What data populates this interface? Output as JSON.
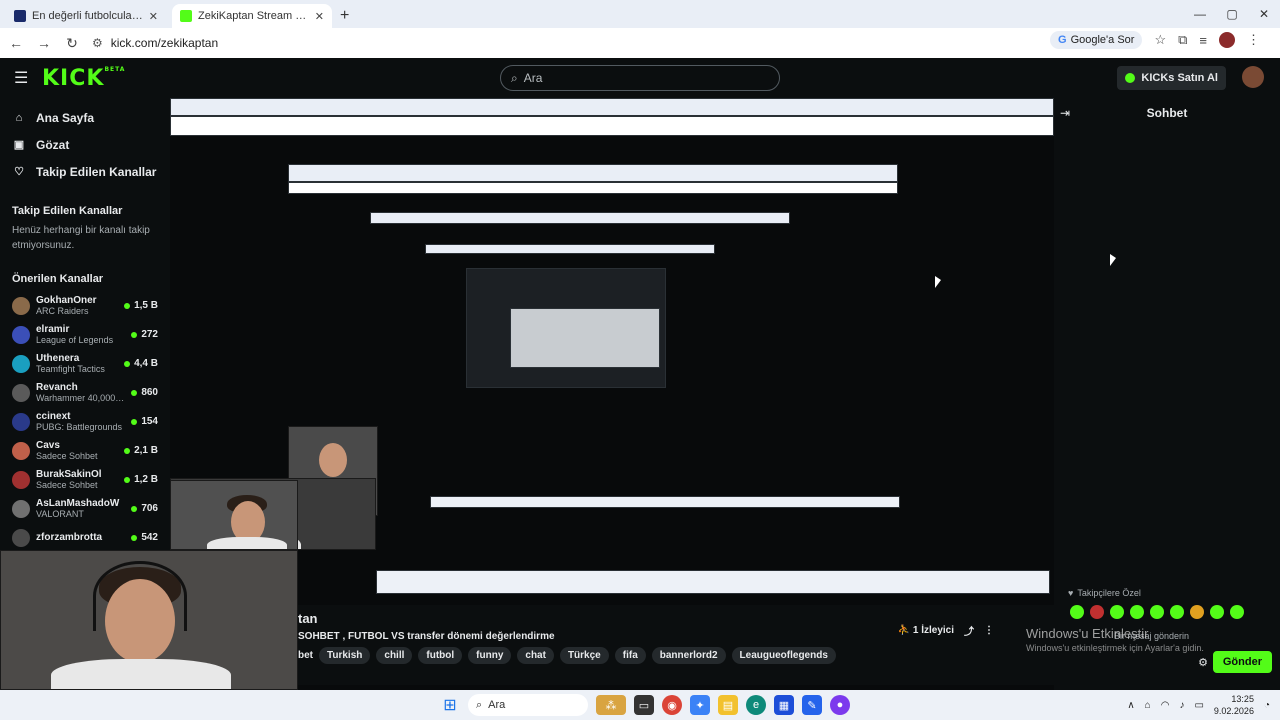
{
  "browser": {
    "tabs": [
      {
        "title": "En değerli futbolcular | Transfer",
        "active": false
      },
      {
        "title": "ZekiKaptan Stream - Watch Live",
        "active": true
      }
    ],
    "url": "kick.com/zekikaptan",
    "google_label": "Google'a Sor"
  },
  "header": {
    "logo": "KICK",
    "beta": "BETA",
    "search_placeholder": "Ara",
    "buy_kicks": "KICKs Satın Al"
  },
  "sidebar": {
    "nav": [
      {
        "label": "Ana Sayfa",
        "icon": "home-icon"
      },
      {
        "label": "Gözat",
        "icon": "browse-icon"
      },
      {
        "label": "Takip Edilen Kanallar",
        "icon": "heart-icon"
      }
    ],
    "following_title": "Takip Edilen Kanallar",
    "following_note": "Henüz herhangi bir kanalı takip etmiyorsunuz.",
    "recommended_title": "Önerilen Kanallar",
    "channels": [
      {
        "name": "GokhanOner",
        "game": "ARC Raiders",
        "count": "1,5 B",
        "color": "#8a6a4a"
      },
      {
        "name": "elramir",
        "game": "League of Legends",
        "count": "272",
        "color": "#3b4fb8"
      },
      {
        "name": "Uthenera",
        "game": "Teamfight Tactics",
        "count": "4,4 B",
        "color": "#1a9fc0"
      },
      {
        "name": "Revanch",
        "game": "Warhammer 40,000: ...",
        "count": "860",
        "color": "#5a5a5a"
      },
      {
        "name": "ccinext",
        "game": "PUBG: Battlegrounds",
        "count": "154",
        "color": "#2a3a8a"
      },
      {
        "name": "Cavs",
        "game": "Sadece Sohbet",
        "count": "2,1 B",
        "color": "#c0604a"
      },
      {
        "name": "BurakSakinOl",
        "game": "Sadece Sohbet",
        "count": "1,2 B",
        "color": "#a03030"
      },
      {
        "name": "AsLanMashadoW",
        "game": "VALORANT",
        "count": "706",
        "color": "#707070"
      },
      {
        "name": "zforzambrotta",
        "game": "",
        "count": "542",
        "color": "#4a4a4a"
      }
    ]
  },
  "chat": {
    "title": "Sohbet",
    "subscribers_only": "Takipçilere Özel",
    "send_label": "Gönder",
    "message_placeholder": "Bir mesaj gönderin"
  },
  "stream": {
    "channel_name": "tan",
    "title": "SOHBET , FUTBOL VS transfer dönemi değerlendirme",
    "category_prefix": "bet",
    "tags": [
      "Turkish",
      "chill",
      "futbol",
      "funny",
      "chat",
      "Türkçe",
      "fifa",
      "bannerlord2",
      "Leaugueoflegends"
    ],
    "viewers": "1 İzleyici"
  },
  "windows": {
    "activate_title": "Windows'u Etkinleştir",
    "activate_sub": "Windows'u etkinleştirmek için Ayarlar'a gidin."
  },
  "taskbar": {
    "search": "Ara",
    "time": "13:25",
    "date": "9.02.2026"
  }
}
